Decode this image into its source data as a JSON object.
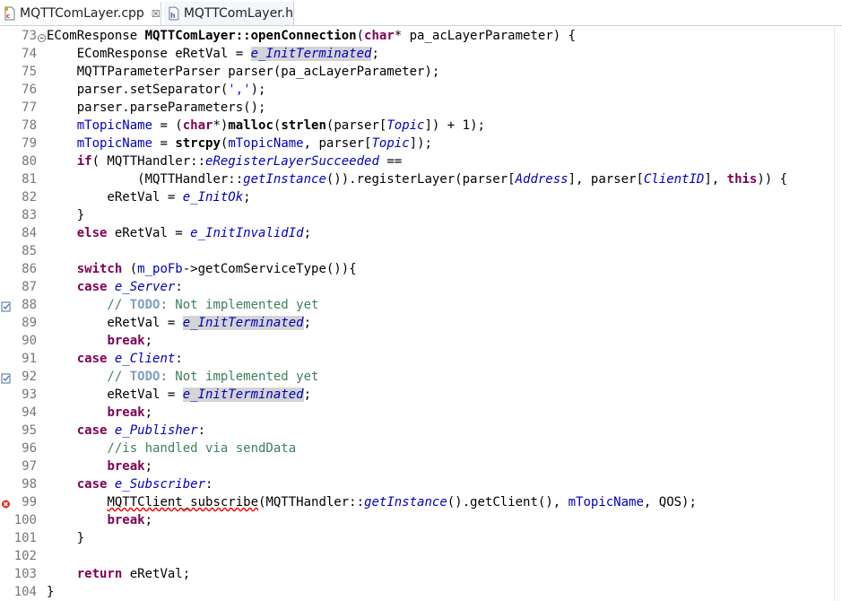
{
  "tabs": [
    {
      "label": "MQTTComLayer.cpp",
      "close": "☒"
    },
    {
      "label": "MQTTComLayer.h"
    }
  ],
  "lines": [
    {
      "n": "73",
      "fold": true
    },
    {
      "n": "74"
    },
    {
      "n": "75"
    },
    {
      "n": "76"
    },
    {
      "n": "77"
    },
    {
      "n": "78"
    },
    {
      "n": "79"
    },
    {
      "n": "80"
    },
    {
      "n": "81"
    },
    {
      "n": "82"
    },
    {
      "n": "83"
    },
    {
      "n": "84"
    },
    {
      "n": "85"
    },
    {
      "n": "86"
    },
    {
      "n": "87"
    },
    {
      "n": "88",
      "marker": "task"
    },
    {
      "n": "89"
    },
    {
      "n": "90"
    },
    {
      "n": "91"
    },
    {
      "n": "92",
      "marker": "task"
    },
    {
      "n": "93"
    },
    {
      "n": "94"
    },
    {
      "n": "95"
    },
    {
      "n": "96"
    },
    {
      "n": "97"
    },
    {
      "n": "98"
    },
    {
      "n": "99",
      "marker": "error"
    },
    {
      "n": "100"
    },
    {
      "n": "101"
    },
    {
      "n": "102"
    },
    {
      "n": "103"
    },
    {
      "n": "104"
    }
  ],
  "code": {
    "l73": [
      "EComResponse ",
      "MQTTComLayer::openConnection",
      "(",
      "char",
      "* pa_acLayerParameter) {"
    ],
    "l74": [
      "    EComResponse eRetVal = ",
      "e_InitTerminated",
      ";"
    ],
    "l75": [
      "    MQTTParameterParser parser(pa_acLayerParameter);"
    ],
    "l76": [
      "    parser.setSeparator(",
      "','",
      ");"
    ],
    "l77": [
      "    parser.parseParameters();"
    ],
    "l78": [
      "    ",
      "mTopicName",
      " = (",
      "char",
      "*)",
      "malloc",
      "(",
      "strlen",
      "(parser[",
      "Topic",
      "]) + 1);"
    ],
    "l79": [
      "    ",
      "mTopicName",
      " = ",
      "strcpy",
      "(",
      "mTopicName",
      ", parser[",
      "Topic",
      "]);"
    ],
    "l80": [
      "    ",
      "if",
      "( MQTTHandler::",
      "eRegisterLayerSucceeded",
      " =="
    ],
    "l81": [
      "            (MQTTHandler::",
      "getInstance",
      "()).registerLayer(parser[",
      "Address",
      "], parser[",
      "ClientID",
      "], ",
      "this",
      ")) {"
    ],
    "l82": [
      "        eRetVal = ",
      "e_InitOk",
      ";"
    ],
    "l83": [
      "    }"
    ],
    "l84": [
      "    ",
      "else",
      " eRetVal = ",
      "e_InitInvalidId",
      ";"
    ],
    "l85": [
      ""
    ],
    "l86": [
      "    ",
      "switch",
      " (",
      "m_poFb",
      "->getComServiceType()){"
    ],
    "l87": [
      "    ",
      "case",
      " ",
      "e_Server",
      ":"
    ],
    "l88": [
      "        // ",
      "TODO",
      ": Not implemented yet"
    ],
    "l89": [
      "        eRetVal = ",
      "e_InitTerminated",
      ";"
    ],
    "l90": [
      "        ",
      "break",
      ";"
    ],
    "l91": [
      "    ",
      "case",
      " ",
      "e_Client",
      ":"
    ],
    "l92": [
      "        // ",
      "TODO",
      ": Not implemented yet"
    ],
    "l93": [
      "        eRetVal = ",
      "e_InitTerminated",
      ";"
    ],
    "l94": [
      "        ",
      "break",
      ";"
    ],
    "l95": [
      "    ",
      "case",
      " ",
      "e_Publisher",
      ":"
    ],
    "l96": [
      "        //is handled via sendData"
    ],
    "l97": [
      "        ",
      "break",
      ";"
    ],
    "l98": [
      "    ",
      "case",
      " ",
      "e_Subscriber",
      ":"
    ],
    "l99": [
      "        ",
      "MQTTClient_subscribe",
      "(MQTTHandler::",
      "getInstance",
      "().getClient(), ",
      "mTopicName",
      ", QOS);"
    ],
    "l100": [
      "        ",
      "break",
      ";"
    ],
    "l101": [
      "    }"
    ],
    "l102": [
      ""
    ],
    "l103": [
      "    ",
      "return",
      " eRetVal;"
    ],
    "l104": [
      "}"
    ]
  }
}
